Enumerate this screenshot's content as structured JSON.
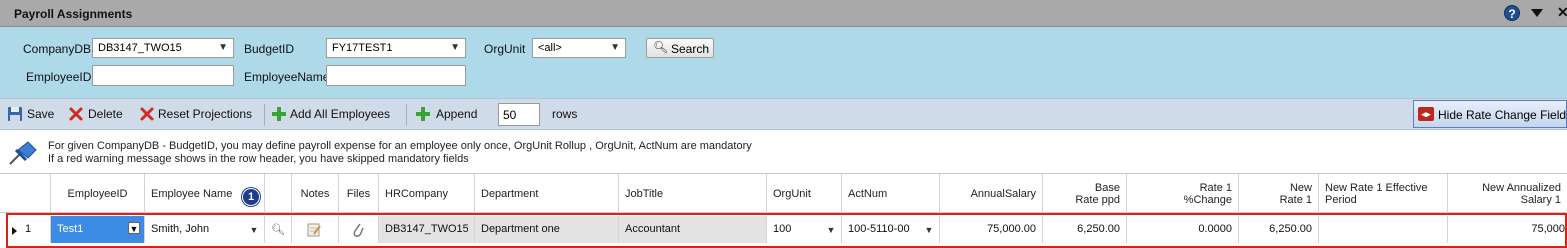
{
  "window": {
    "title": "Payroll Assignments",
    "help_icon": "help-icon",
    "help_glyph": "?",
    "collapse_icon": "collapse-icon",
    "close_icon": "close-icon",
    "close_glyph": "✕"
  },
  "filters": {
    "company_label": "CompanyDB",
    "company_value": "DB3147_TWO15",
    "budget_label": "BudgetID",
    "budget_value": "FY17TEST1",
    "orgunit_label": "OrgUnit",
    "orgunit_value": "<all>",
    "search_label": "Search",
    "employeeid_label": "EmployeeID",
    "employeeid_value": "",
    "employeename_label": "EmployeeName",
    "employeename_value": ""
  },
  "toolbar": {
    "save_label": "Save",
    "delete_label": "Delete",
    "reset_label": "Reset Projections",
    "add_all_label": "Add All Employees",
    "append_label": "Append",
    "rows_value": "50",
    "rows_label": "rows",
    "hide_rate_label": "Hide Rate Change Fields"
  },
  "info": {
    "line1": "For given CompanyDB - BudgetID, you may define payroll expense for an employee only once, OrgUnit Rollup , OrgUnit, ActNum are mandatory",
    "line2": "If a red warning message shows in the row header, you have skipped mandatory fields"
  },
  "grid": {
    "headers": {
      "employee_id": "EmployeeID",
      "employee_name": "Employee Name",
      "badge": "1",
      "notes": "Notes",
      "files": "Files",
      "hrcompany": "HRCompany",
      "department": "Department",
      "jobtitle": "JobTitle",
      "orgunit": "OrgUnit",
      "actnum": "ActNum",
      "annual_salary": "AnnualSalary",
      "base_rate": "Base Rate ppd",
      "rate1_change": "Rate 1 %Change",
      "new_rate1": "New Rate 1",
      "new_rate1_eff": "New Rate 1 Effective Period",
      "new_annualized": "New Annualized Salary 1"
    },
    "rows": [
      {
        "row_num": "1",
        "employee_id": "Test1",
        "employee_name": "Smith, John",
        "hrcompany": "DB3147_TWO15",
        "department": "Department one",
        "jobtitle": "Accountant",
        "orgunit": "100",
        "actnum": "100-5110-00",
        "annual_salary": "75,000.00",
        "base_rate": "6,250.00",
        "rate1_change": "0.0000",
        "new_rate1": "6,250.00",
        "new_rate1_eff": "",
        "new_annualized": "75,000"
      }
    ]
  },
  "colors": {
    "filter_bg": "#aed9e8",
    "toolbar_bg": "#cfdbe8",
    "selected_cell": "#3c8ce6",
    "warning_border": "#d8231b"
  }
}
